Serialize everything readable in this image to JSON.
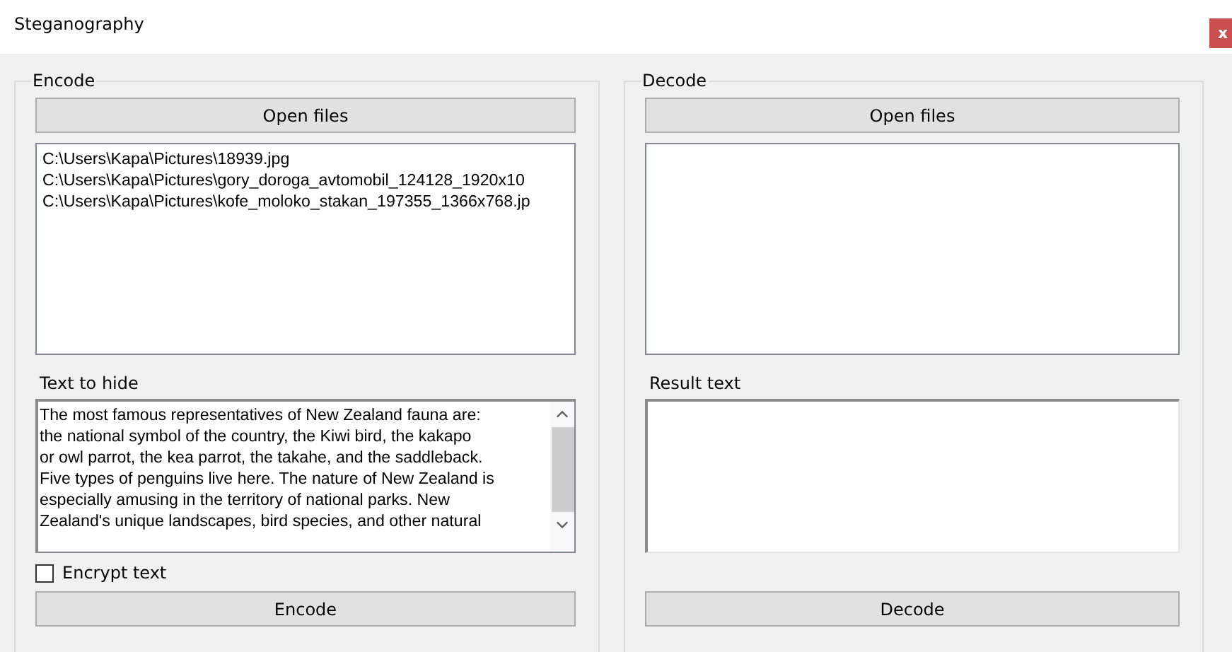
{
  "window": {
    "title": "Steganography",
    "close": "x"
  },
  "encode": {
    "title": "Encode",
    "open_button": "Open files",
    "files": [
      "C:\\Users\\Kapa\\Pictures\\18939.jpg",
      "C:\\Users\\Kapa\\Pictures\\gory_doroga_avtomobil_124128_1920x10",
      "C:\\Users\\Kapa\\Pictures\\kofe_moloko_stakan_197355_1366x768.jp"
    ],
    "text_label": "Text to hide",
    "text_lines": [
      "The most famous representatives of New Zealand fauna are:",
      "the national symbol of the country, the Kiwi bird, the kakapo",
      "or owl parrot, the kea parrot, the takahe, and the saddleback.",
      "Five types of penguins live here. The nature of New Zealand is",
      "especially amusing in the territory of national parks. New",
      "Zealand's unique landscapes, bird species, and other natural"
    ],
    "encrypt": {
      "label": "Encrypt text",
      "checked": false
    },
    "action_button": "Encode"
  },
  "decode": {
    "title": "Decode",
    "open_button": "Open files",
    "result_label": "Result text",
    "action_button": "Decode"
  }
}
